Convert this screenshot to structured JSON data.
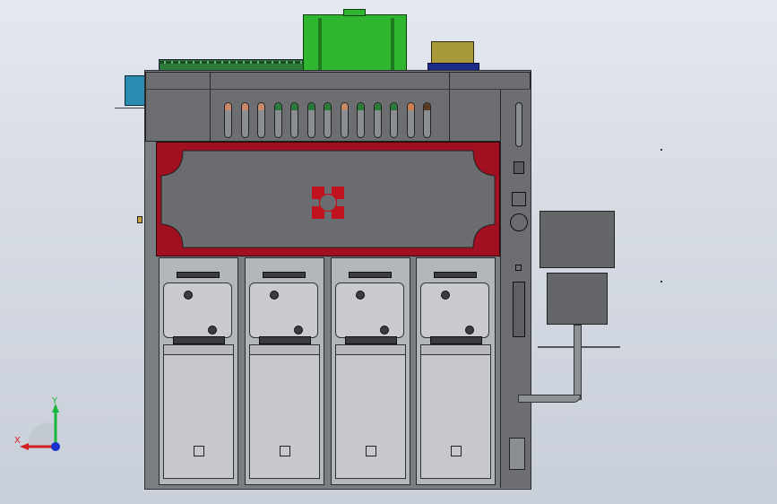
{
  "viewport": {
    "background": "#d8dde5"
  },
  "triad": {
    "x_label": "X",
    "y_label": "Y",
    "x_color": "#d21f1f",
    "y_color": "#19b43a",
    "z_color": "#1a2fd0"
  },
  "colors": {
    "frame": "#5e6064",
    "red_panel": "#a01020",
    "green_cover": "#2fb52f",
    "pcb_green": "#2c7a3a",
    "pipe": "#8d9096"
  },
  "indicator_lamps": [
    "#c98a6a",
    "#c98a6a",
    "#c98a6a",
    "#2a7a3a",
    "#2a7a3a",
    "#2a7a3a",
    "#2a7a3a",
    "#c98a6a",
    "#2a7a3a",
    "#2a7a3a",
    "#2a7a3a",
    "#d08050",
    "#5a3a20"
  ],
  "units": [
    {
      "id": 1
    },
    {
      "id": 2
    },
    {
      "id": 3
    },
    {
      "id": 4
    }
  ]
}
